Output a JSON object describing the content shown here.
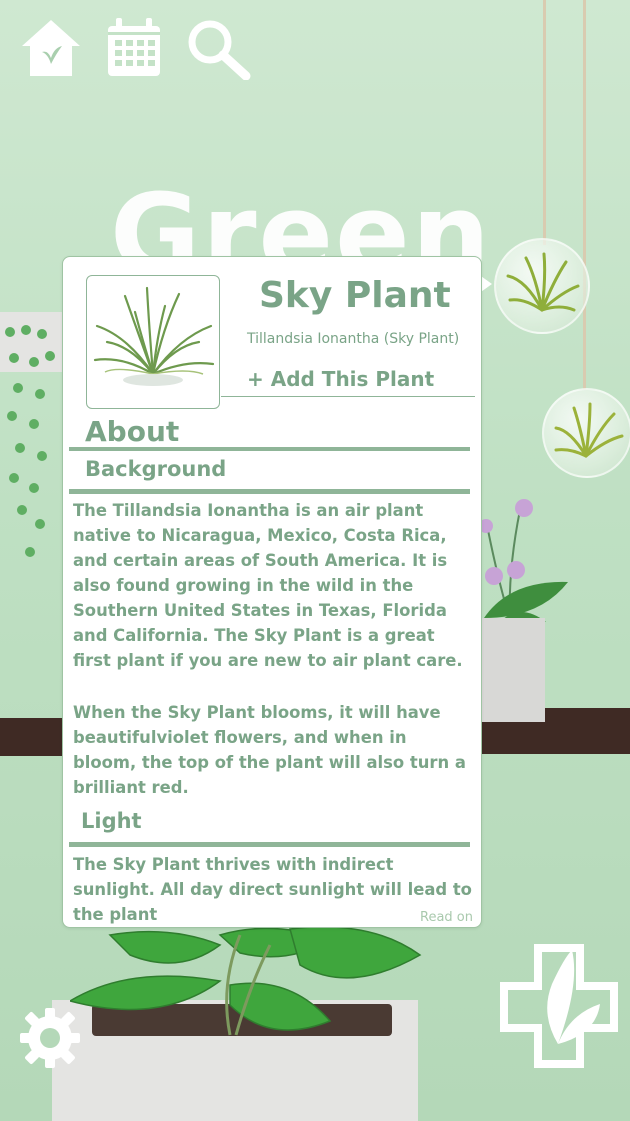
{
  "nav": {
    "home_icon": "home-icon",
    "calendar_icon": "calendar-icon",
    "search_icon": "search-icon"
  },
  "background": {
    "title_text": "Green"
  },
  "card": {
    "name": "Sky Plant",
    "scientific_name": "Tillandsia Ionantha (Sky Plant)",
    "add_label": "+ Add This Plant",
    "about_heading": "About",
    "background_heading": "Background",
    "background_p1": "The Tillandsia Ionantha is an air plant native to Nicaragua, Mexico, Costa Rica, and certain areas of South America. It is also found growing in the wild in the Southern United States in Texas, Florida and California. The Sky Plant is a great first plant if you are new to air plant care.",
    "background_p2": "When the Sky Plant blooms, it will have beautifulviolet flowers, and when in bloom, the top of the plant will also turn a brilliant red.",
    "light_heading": "Light",
    "light_p": "The Sky Plant thrives with indirect sunlight. All day direct sunlight will lead to the plant",
    "read_on_label": "Read on"
  },
  "bottom": {
    "settings_icon": "gear-icon",
    "plant_care_icon": "plant-cross-icon"
  },
  "colors": {
    "accent": "#7aa487",
    "background": "#c4e2c7",
    "shelf": "#3f2a24"
  }
}
